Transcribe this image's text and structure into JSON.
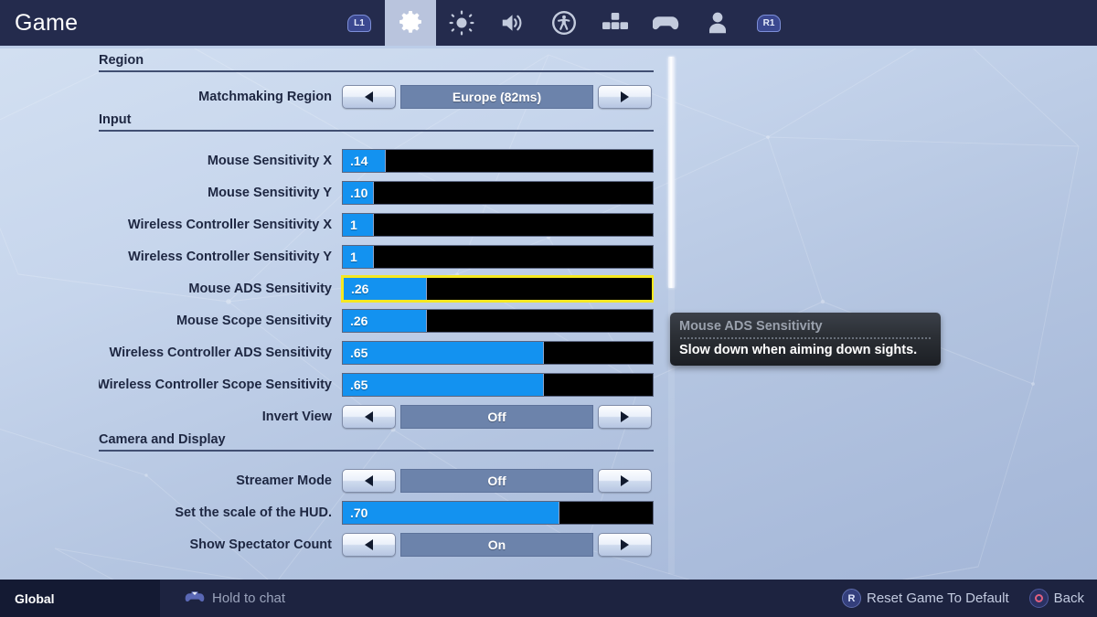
{
  "header": {
    "title": "Game",
    "left_bumper": "L1",
    "right_bumper": "R1",
    "nav_items": [
      {
        "name": "settings",
        "icon": "gear-icon",
        "active": true
      },
      {
        "name": "brightness",
        "icon": "brightness-icon",
        "active": false
      },
      {
        "name": "audio",
        "icon": "speaker-icon",
        "active": false
      },
      {
        "name": "accessibility",
        "icon": "accessibility-icon",
        "active": false
      },
      {
        "name": "keyboard-controls",
        "icon": "keybinds-icon",
        "active": false
      },
      {
        "name": "controller",
        "icon": "gamepad-icon",
        "active": false
      },
      {
        "name": "account",
        "icon": "person-icon",
        "active": false
      }
    ]
  },
  "sections": [
    {
      "title": "Region",
      "rows": [
        {
          "type": "stepper",
          "label": "Matchmaking Region",
          "value": "Europe (82ms)",
          "prev": "◀",
          "next": "▶"
        }
      ]
    },
    {
      "title": "Input",
      "rows": [
        {
          "type": "slider",
          "label": "Mouse Sensitivity X",
          "value": ".14",
          "fill_pct": 14,
          "selected": false
        },
        {
          "type": "slider",
          "label": "Mouse Sensitivity Y",
          "value": ".10",
          "fill_pct": 10,
          "selected": false
        },
        {
          "type": "slider",
          "label": "Wireless Controller Sensitivity X",
          "value": "1",
          "fill_pct": 10,
          "selected": false
        },
        {
          "type": "slider",
          "label": "Wireless Controller Sensitivity Y",
          "value": "1",
          "fill_pct": 10,
          "selected": false
        },
        {
          "type": "slider",
          "label": "Mouse ADS Sensitivity",
          "value": ".26",
          "fill_pct": 27,
          "selected": true
        },
        {
          "type": "slider",
          "label": "Mouse Scope Sensitivity",
          "value": ".26",
          "fill_pct": 27,
          "selected": false
        },
        {
          "type": "slider",
          "label": "Wireless Controller ADS Sensitivity",
          "value": ".65",
          "fill_pct": 65,
          "selected": false
        },
        {
          "type": "slider",
          "label": "Wireless Controller Scope Sensitivity",
          "value": ".65",
          "fill_pct": 65,
          "selected": false
        },
        {
          "type": "stepper",
          "label": "Invert View",
          "value": "Off",
          "prev": "◀",
          "next": "▶"
        }
      ]
    },
    {
      "title": "Camera and Display",
      "rows": [
        {
          "type": "stepper",
          "label": "Streamer Mode",
          "value": "Off",
          "prev": "◀",
          "next": "▶"
        },
        {
          "type": "slider",
          "label": "Set the scale of the HUD.",
          "value": ".70",
          "fill_pct": 70,
          "selected": false
        },
        {
          "type": "stepper",
          "label": "Show Spectator Count",
          "value": "On",
          "prev": "◀",
          "next": "▶"
        }
      ]
    }
  ],
  "tooltip": {
    "title": "Mouse ADS Sensitivity",
    "description": "Slow down when aiming down sights."
  },
  "footer": {
    "channel": "Global",
    "chat_hint": "Hold to chat",
    "reset_label": "Reset Game To Default",
    "reset_button": "R",
    "back_label": "Back"
  },
  "colors": {
    "accent_blue": "#1392f0",
    "selection_yellow": "#f5e821",
    "topbar_navy": "#242b4d",
    "stepper_blue": "#6c83ab"
  }
}
